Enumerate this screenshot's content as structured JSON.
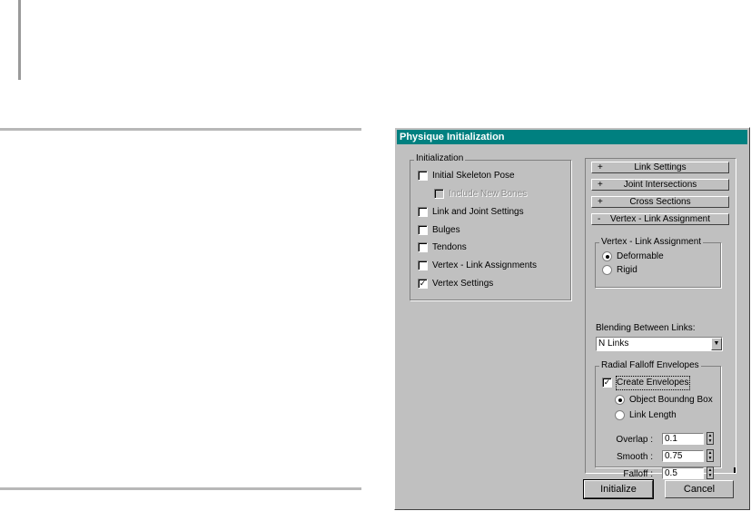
{
  "dialog": {
    "title": "Physique Initialization",
    "initialization": {
      "label": "Initialization",
      "items": [
        {
          "label": "Initial Skeleton Pose",
          "checked": false,
          "enabled": true
        },
        {
          "label": "Include New Bones",
          "checked": false,
          "enabled": false
        },
        {
          "label": "Link and Joint Settings",
          "checked": false,
          "enabled": true
        },
        {
          "label": "Bulges",
          "checked": false,
          "enabled": true
        },
        {
          "label": "Tendons",
          "checked": false,
          "enabled": true
        },
        {
          "label": "Vertex - Link Assignments",
          "checked": false,
          "enabled": true
        },
        {
          "label": "Vertex Settings",
          "checked": true,
          "enabled": true
        }
      ]
    },
    "rollouts": [
      {
        "sign": "+",
        "label": "Link Settings"
      },
      {
        "sign": "+",
        "label": "Joint Intersections"
      },
      {
        "sign": "+",
        "label": "Cross Sections"
      },
      {
        "sign": "-",
        "label": "Vertex - Link Assignment"
      }
    ],
    "vertex_link_assignment": {
      "group_label": "Vertex - Link Assignment",
      "options": [
        "Deformable",
        "Rigid"
      ],
      "selected": "Deformable"
    },
    "blending": {
      "label": "Blending Between Links:",
      "value": "N Links"
    },
    "radial_falloff": {
      "group_label": "Radial Falloff Envelopes",
      "create_envelopes_label": "Create Envelopes",
      "create_envelopes_checked": true,
      "options": [
        "Object Boundng Box",
        "Link Length"
      ],
      "selected": "Object Boundng Box",
      "overlap_label": "Overlap :",
      "overlap_value": "0.1",
      "smooth_label": "Smooth :",
      "smooth_value": "0.75",
      "falloff_label": "Falloff :",
      "falloff_value": "0.5"
    },
    "buttons": {
      "initialize": "Initialize",
      "cancel": "Cancel"
    },
    "check_mark": "✓"
  }
}
